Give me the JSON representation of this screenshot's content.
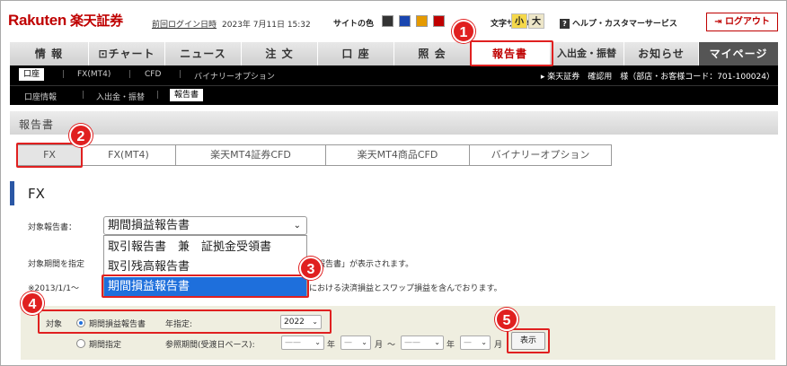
{
  "header": {
    "logo": "Rakuten",
    "logo_sec": "楽天証券",
    "last_login_label": "前回ログイン日時",
    "last_login_value": "2023年 7月11日 15:32",
    "site_color_label": "サイトの色",
    "site_colors": [
      "#333333",
      "#1a46b0",
      "#e59a00",
      "#bf0000"
    ],
    "font_size_label": "文字サイズ",
    "font_small": "小",
    "font_large": "大",
    "help": "ヘルプ・カスタマーサービス",
    "logout": "ログアウト"
  },
  "main_nav": [
    {
      "label": "情 報"
    },
    {
      "label": "⊡チャート"
    },
    {
      "label": "ニュース"
    },
    {
      "label": "注 文"
    },
    {
      "label": "口 座"
    },
    {
      "label": "照 会"
    },
    {
      "label": "報告書"
    },
    {
      "label": "入出金・振替"
    },
    {
      "label": "お知らせ"
    },
    {
      "label": "マイページ"
    }
  ],
  "sub_nav1": {
    "items": [
      "口座",
      "FX(MT4)",
      "CFD",
      "バイナリーオプション"
    ],
    "user_info": "▸ 楽天証券　確認用　様（部店・お客様コード：701-100024）"
  },
  "sub_nav2": {
    "items": [
      "口座情報",
      "入出金・振替",
      "報告書"
    ]
  },
  "section_title": "報告書",
  "sub_tabs": [
    "FX",
    "FX(MT4)",
    "楽天MT4証券CFD",
    "楽天MT4商品CFD",
    "バイナリーオプション"
  ],
  "page_title": "FX",
  "report_select": {
    "label": "対象報告書：",
    "value": "期間損益報告書",
    "options": [
      "取引報告書　兼　証拠金受領書",
      "取引残高報告書",
      "期間損益報告書"
    ]
  },
  "period_label": "対象期間を指定",
  "period_hint_tail": "益報告書」が表示されます。",
  "note_head": "※2013/1/1〜",
  "note_tail": "における決済損益とスワップ損益を含んでおります。",
  "filter": {
    "target_label": "対象",
    "radio1": "期間損益報告書",
    "year_label": "年指定:",
    "year_value": "2022",
    "radio2": "期間指定",
    "range_label": "参照期間(受渡日ベース):",
    "dash": "——",
    "short_dash": "—",
    "year_unit": "年",
    "month_unit": "月",
    "tilde": "〜",
    "show_button": "表示"
  },
  "steps": [
    "1",
    "2",
    "3",
    "4",
    "5"
  ]
}
